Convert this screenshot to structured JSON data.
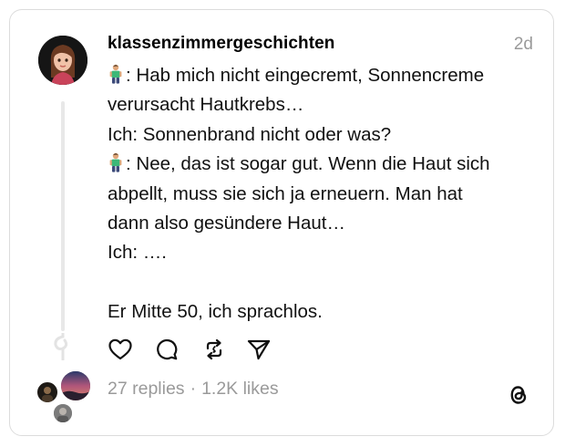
{
  "post": {
    "username": "klassenzimmergeschichten",
    "timestamp": "2d",
    "lines": [
      {
        "emoji": true,
        "text": ": Hab mich nicht eingecremt, Sonnencreme"
      },
      {
        "emoji": false,
        "text": "verursacht Hautkrebs…"
      },
      {
        "emoji": false,
        "text": "Ich: Sonnenbrand nicht oder was?"
      },
      {
        "emoji": true,
        "text": ": Nee, das ist sogar gut. Wenn die Haut sich"
      },
      {
        "emoji": false,
        "text": "abpellt, muss sie sich ja erneuern. Man hat"
      },
      {
        "emoji": false,
        "text": "dann also gesündere Haut…"
      },
      {
        "emoji": false,
        "text": "Ich: …."
      },
      {
        "emoji": false,
        "text": ""
      },
      {
        "emoji": false,
        "text": "Er Mitte 50, ich sprachlos."
      }
    ]
  },
  "stats": {
    "replies": "27 replies",
    "separator": "·",
    "likes": "1.2K likes"
  },
  "icons": {
    "like": "heart-icon",
    "reply": "comment-icon",
    "repost": "repost-icon",
    "share": "send-icon",
    "emoji": "man-emoji-icon",
    "brand": "threads-logo-icon"
  },
  "colors": {
    "text": "#111111",
    "muted": "#9a9a9a",
    "border": "#dcdcdc",
    "thread_line": "#e8e8e8",
    "emoji_shirt": "#3cb878"
  }
}
